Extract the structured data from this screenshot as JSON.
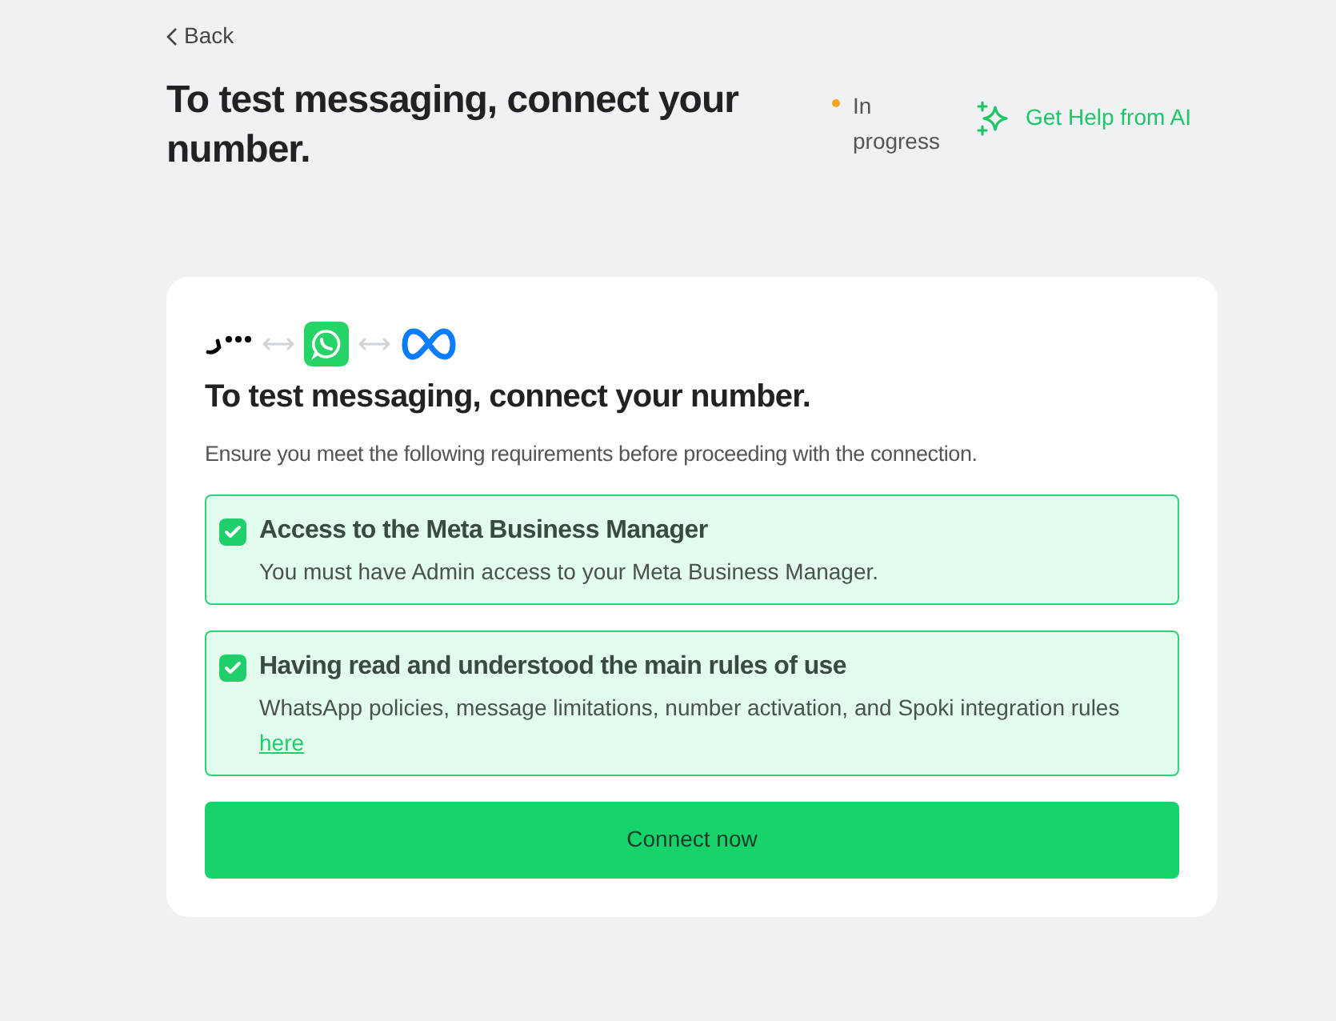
{
  "back": "Back",
  "title": "To test messaging, connect your number.",
  "status": {
    "label": "In progress",
    "color": "#f5a524"
  },
  "help_button": "Get Help from AI",
  "card": {
    "title": "To test messaging, connect your number.",
    "subtitle": "Ensure you meet the following requirements before proceeding with the connection.",
    "requirements": [
      {
        "title": "Access to the Meta Business Manager",
        "description": "You must have Admin access to your Meta Business Manager.",
        "checked": true
      },
      {
        "title": "Having read and understood the main rules of use",
        "description": "WhatsApp policies, message limitations, number activation, and Spoki integration rules",
        "link": "here",
        "checked": true
      }
    ],
    "button": "Connect now"
  }
}
